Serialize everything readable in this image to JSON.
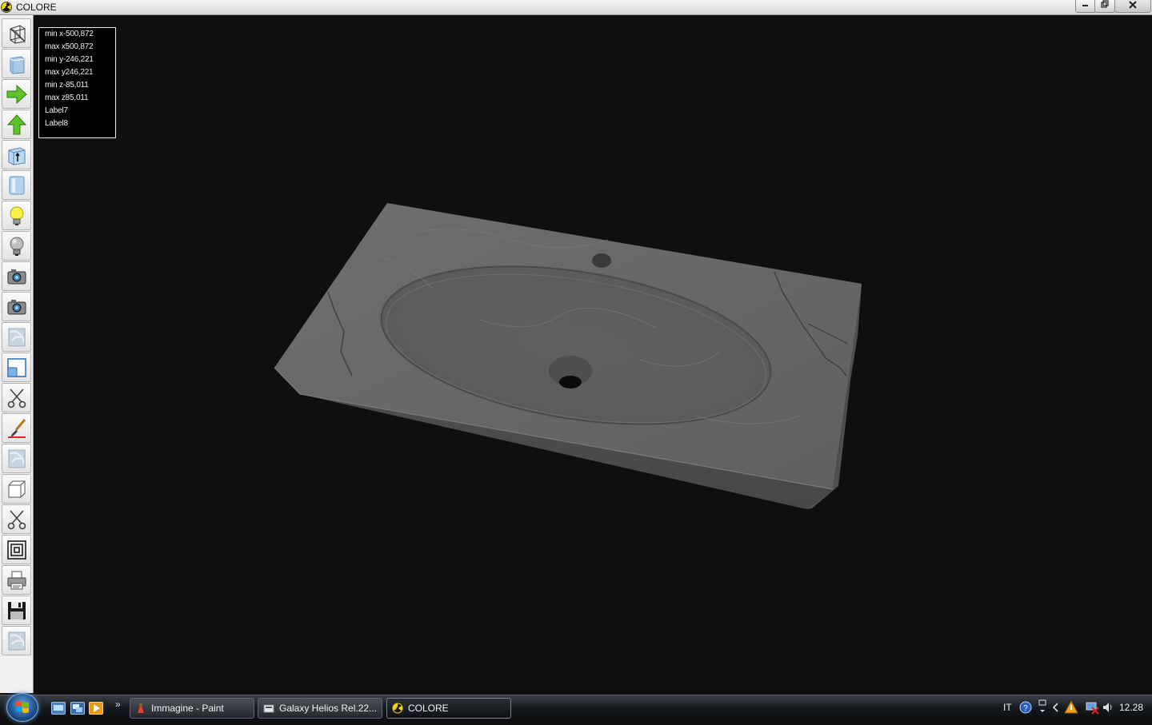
{
  "window": {
    "title": "COLORE",
    "minimize_icon": "minimize-icon",
    "maximize_icon": "restore-icon",
    "close_icon": "close-icon"
  },
  "toolbar": {
    "tools": [
      "wireframe-cube-icon",
      "solid-cube-icon",
      "arrow-right-icon",
      "arrow-up-icon",
      "cube-pointer-icon",
      "cylinder-icon",
      "light-bulb-on-icon",
      "light-bulb-off-icon",
      "camera-icon",
      "camera-alt-icon",
      "texture-icon",
      "window-icon",
      "scissors-icon",
      "brush-icon",
      "texture-alt-icon",
      "box-icon",
      "scissors-alt-icon",
      "nested-squares-icon",
      "printer-icon",
      "floppy-disk-icon",
      "texture-third-icon"
    ]
  },
  "info_panel": {
    "lines": [
      "min x-500,872",
      "max x500,872",
      "min y-246,221",
      "max y246,221",
      "min z-85,011",
      "max z85,011",
      "Label7",
      "Label8"
    ]
  },
  "taskbar": {
    "start_icon": "windows-start-icon",
    "quicklaunch": [
      "show-desktop-icon",
      "switch-windows-icon",
      "media-player-icon"
    ],
    "more_label": "»",
    "tasks": [
      {
        "label": "Immagine - Paint",
        "icon": "paint-icon",
        "active": false
      },
      {
        "label": "Galaxy Helios  Rel.22...",
        "icon": "folder-icon",
        "active": false
      },
      {
        "label": "COLORE",
        "icon": "radiation-icon",
        "active": true
      }
    ],
    "tray": {
      "language": "IT",
      "clock": "12.28"
    }
  },
  "colors": {
    "viewport_background": "#0f0f0f",
    "marble": "#6b6b6b"
  }
}
